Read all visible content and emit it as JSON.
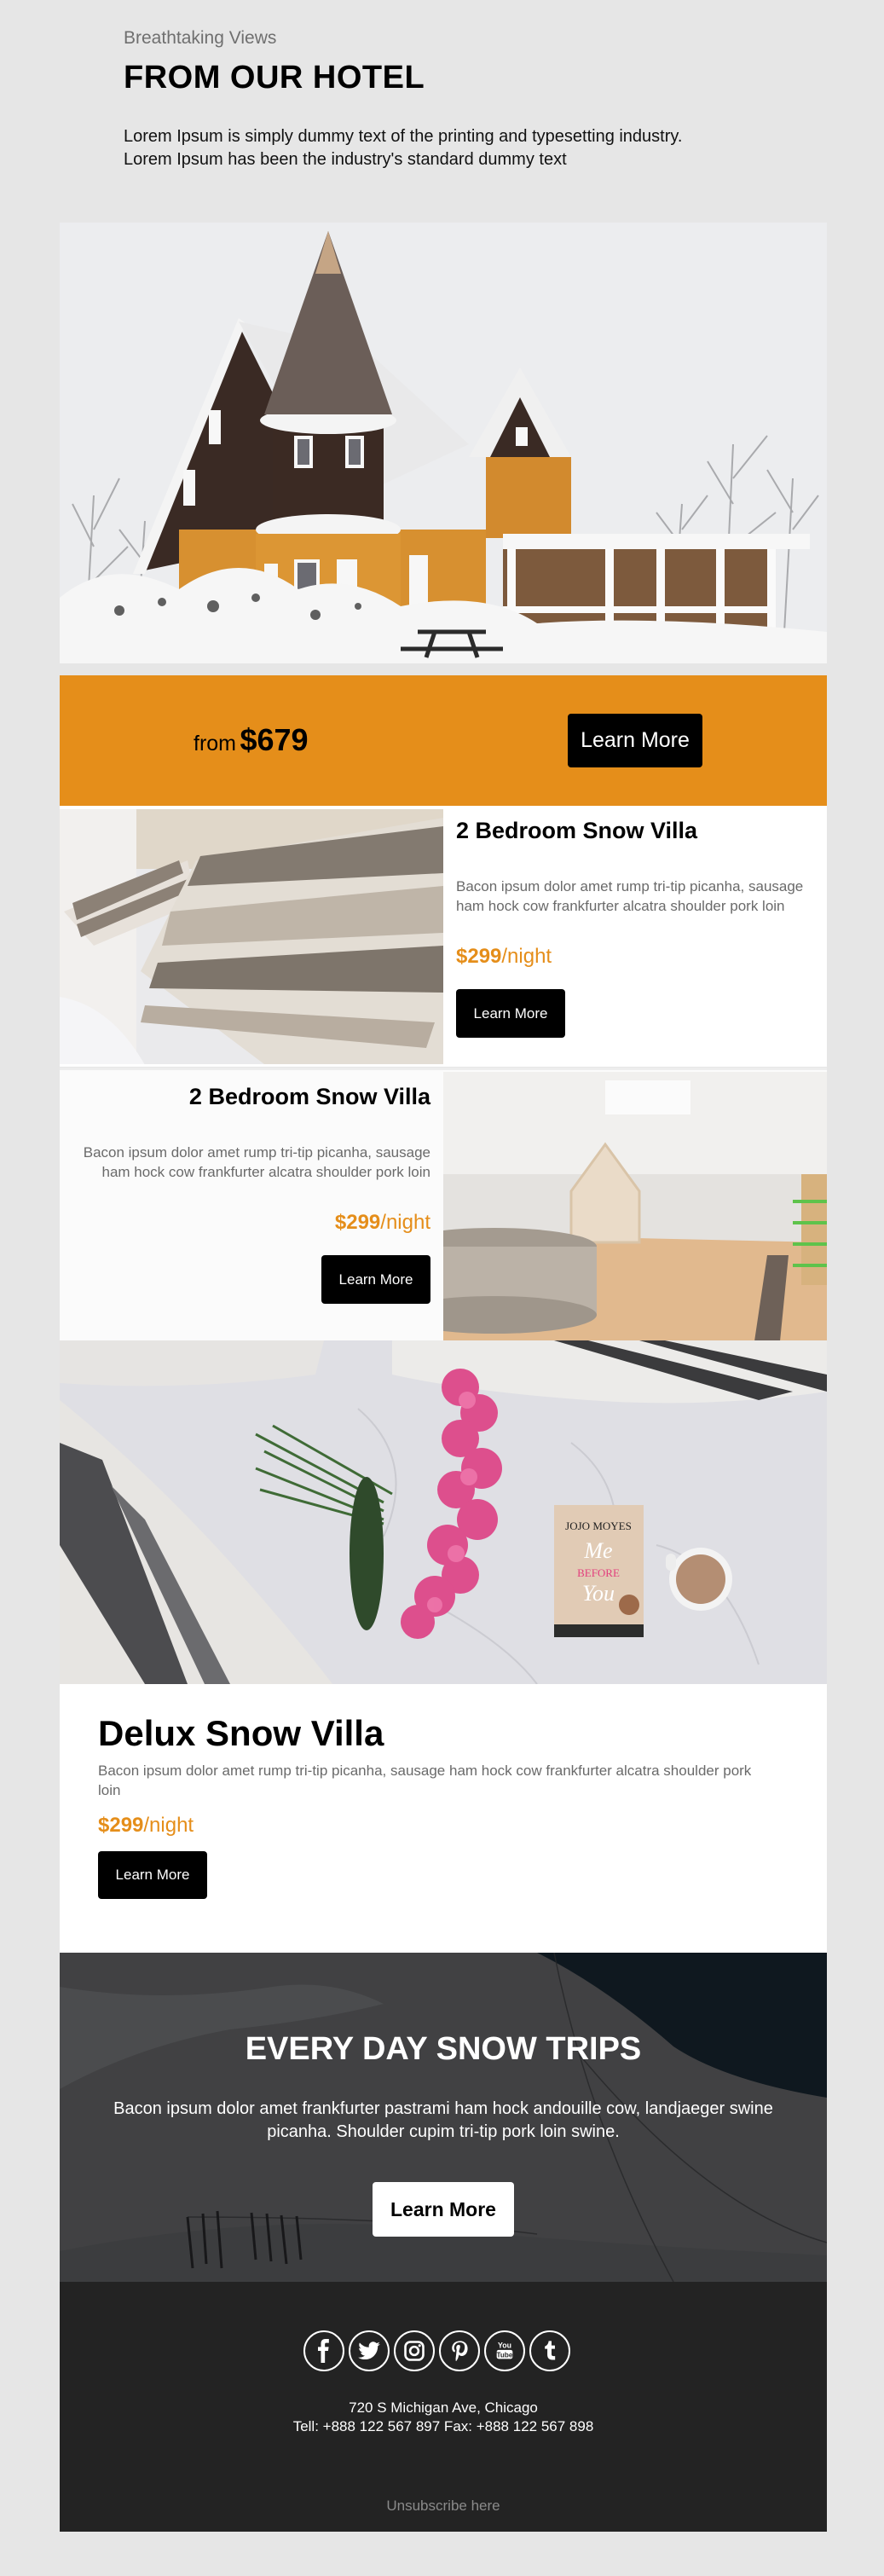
{
  "header": {
    "eyebrow": "Breathtaking Views",
    "title": "FROM OUR HOTEL",
    "intro_line1": "Lorem Ipsum is simply dummy text of the printing and typesetting industry.",
    "intro_line2": "Lorem Ipsum has been the industry's standard dummy text"
  },
  "hero": {
    "image": "snowy-victorian-house-photo"
  },
  "promo": {
    "from_label": "from",
    "price": "$679",
    "button_label": "Learn More"
  },
  "villas": [
    {
      "image": "striped-pillows-photo",
      "title": "2 Bedroom Snow Villa",
      "description": "Bacon ipsum dolor amet rump tri-tip picanha, sausage ham hock cow frankfurter alcatra shoulder pork loin",
      "price": "$299",
      "price_unit": "/night",
      "button_label": "Learn More"
    },
    {
      "image": "bright-living-room-photo",
      "title": "2 Bedroom Snow Villa",
      "description": "Bacon ipsum dolor amet rump tri-tip picanha, sausage ham hock cow frankfurter alcatra shoulder pork loin",
      "price": "$299",
      "price_unit": "/night",
      "button_label": "Learn More"
    }
  ],
  "delux": {
    "image": "flowers-book-coffee-on-bed-photo",
    "book_author": "JOJO MOYES",
    "book_title_1": "Me",
    "book_title_2": "BEFORE",
    "book_title_3": "You",
    "title": "Delux Snow Villa",
    "description": "Bacon ipsum dolor amet rump tri-tip picanha, sausage ham hock cow frankfurter alcatra shoulder pork loin",
    "price": "$299",
    "price_unit": "/night",
    "button_label": "Learn More"
  },
  "trips": {
    "title": "EVERY DAY SNOW TRIPS",
    "description": "Bacon ipsum dolor amet frankfurter pastrami ham hock andouille cow, landjaeger swine picanha. Shoulder cupim tri-tip pork loin swine.",
    "button_label": "Learn More"
  },
  "footer": {
    "social": [
      "facebook",
      "twitter",
      "instagram",
      "pinterest",
      "youtube",
      "tumblr"
    ],
    "youtube_you": "You",
    "youtube_tube": "Tube",
    "address": "720 S Michigan Ave, Chicago",
    "contact": "Tell: +888 122 567 897 Fax: +888 122 567 898",
    "unsubscribe": "Unsubscribe here"
  },
  "colors": {
    "accent": "#e58e1a",
    "page_bg": "#e6e6e6",
    "footer_bg": "#232323",
    "button_bg": "#000000"
  }
}
